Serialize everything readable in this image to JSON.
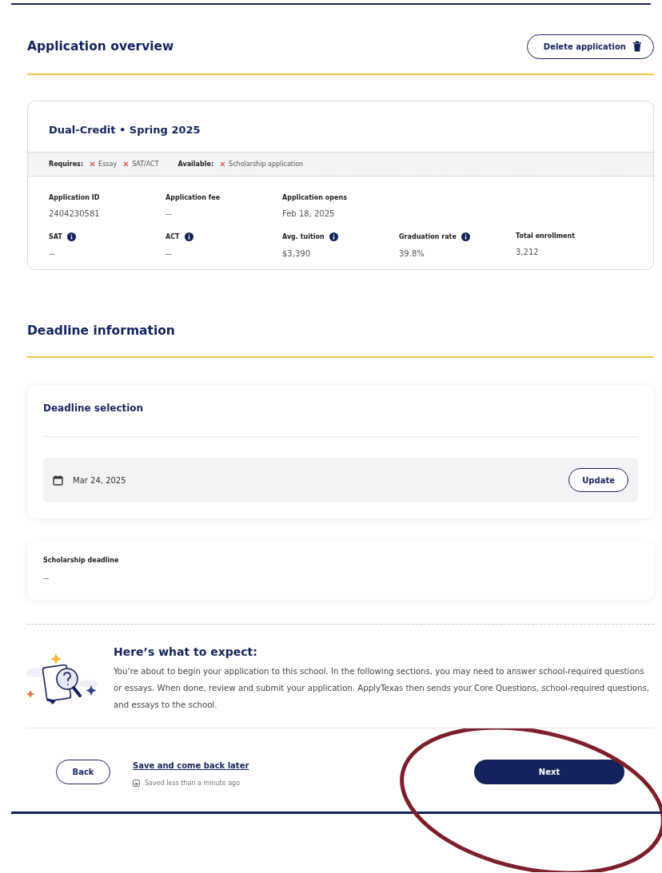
{
  "overview": {
    "title": "Application overview",
    "delete_button": "Delete application"
  },
  "application": {
    "title": "Dual-Credit • Spring 2025",
    "requires_label": "Requires:",
    "requires": [
      {
        "label": "Essay",
        "met": false
      },
      {
        "label": "SAT/ACT",
        "met": false
      }
    ],
    "available_label": "Available:",
    "available": [
      {
        "label": "Scholarship application",
        "met": false
      }
    ],
    "facts_row_1": [
      {
        "label": "Application ID",
        "value": "2404230581",
        "info": false
      },
      {
        "label": "Application fee",
        "value": "--",
        "info": false
      },
      {
        "label": "Application opens",
        "value": "Feb 18, 2025",
        "info": false
      }
    ],
    "facts_row_2": [
      {
        "label": "SAT",
        "value": "--",
        "info": true
      },
      {
        "label": "ACT",
        "value": "--",
        "info": true
      },
      {
        "label": "Avg. tuition",
        "value": "$3,390",
        "info": true
      },
      {
        "label": "Graduation rate",
        "value": "39.8%",
        "info": true
      },
      {
        "label": "Total enrollment",
        "value": "3,212",
        "info": false
      }
    ]
  },
  "deadline": {
    "title": "Deadline information",
    "selection_title": "Deadline selection",
    "date": "Mar 24, 2025",
    "update_button": "Update",
    "scholarship_label": "Scholarship deadline",
    "scholarship_value": "--"
  },
  "expect": {
    "title": "Here’s what to expect:",
    "text": "You’re about to begin your application to this school. In the following sections, you may need to answer school-required questions or essays. When done, review and submit your application. ApplyTexas then sends your Core Questions, school-required questions, and essays to the school."
  },
  "footer": {
    "back_button": "Back",
    "save_link": "Save and come back later",
    "saved_status": "Saved less than a minute ago",
    "next_button": "Next"
  }
}
